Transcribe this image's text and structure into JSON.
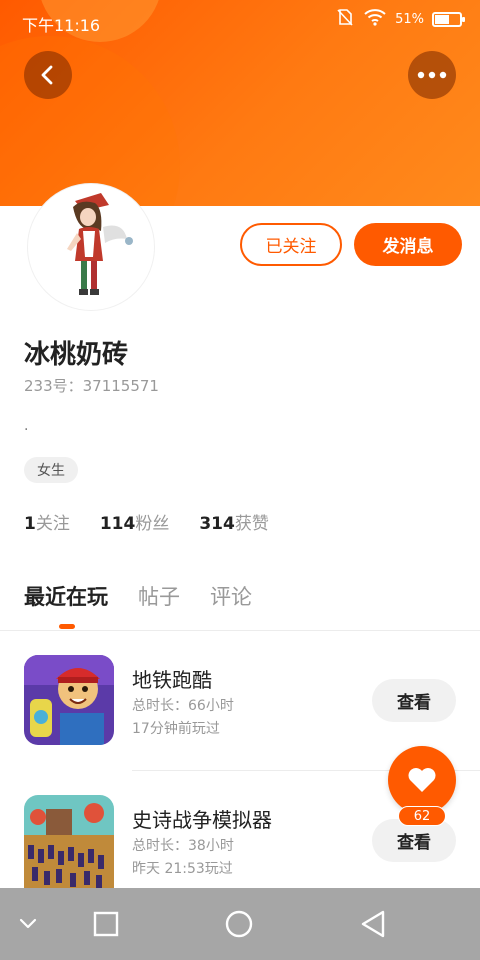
{
  "status_bar": {
    "time": "下午11:16",
    "battery_pct": "51%",
    "icons": [
      "no-sim-icon",
      "wifi-icon",
      "battery-icon"
    ]
  },
  "header": {
    "back_icon": "chevron-left-icon",
    "more_icon": "more-dots-icon",
    "accent_color": "#ff5a00"
  },
  "profile": {
    "name": "冰桃奶砖",
    "id_text": "233号：37115571",
    "bio": ".",
    "gender": "女生",
    "follow_label": "已关注",
    "message_label": "发消息"
  },
  "stats": [
    {
      "num": "1",
      "label": "关注"
    },
    {
      "num": "114",
      "label": "粉丝"
    },
    {
      "num": "314",
      "label": "获赞"
    }
  ],
  "tabs": [
    {
      "label": "最近在玩",
      "active": true
    },
    {
      "label": "帖子",
      "active": false
    },
    {
      "label": "评论",
      "active": false
    }
  ],
  "games": [
    {
      "name": "地铁跑酷",
      "duration": "总时长：66小时",
      "last_played": "17分钟前玩过",
      "button": "查看"
    },
    {
      "name": "史诗战争模拟器",
      "duration": "总时长：38小时",
      "last_played": "昨天 21:53玩过",
      "button": "查看"
    }
  ],
  "fab": {
    "icon": "heart-icon",
    "count": "62"
  },
  "nav_bar": {
    "icons": [
      "nav-hide-icon",
      "recent-apps-icon",
      "home-icon",
      "back-icon"
    ]
  }
}
